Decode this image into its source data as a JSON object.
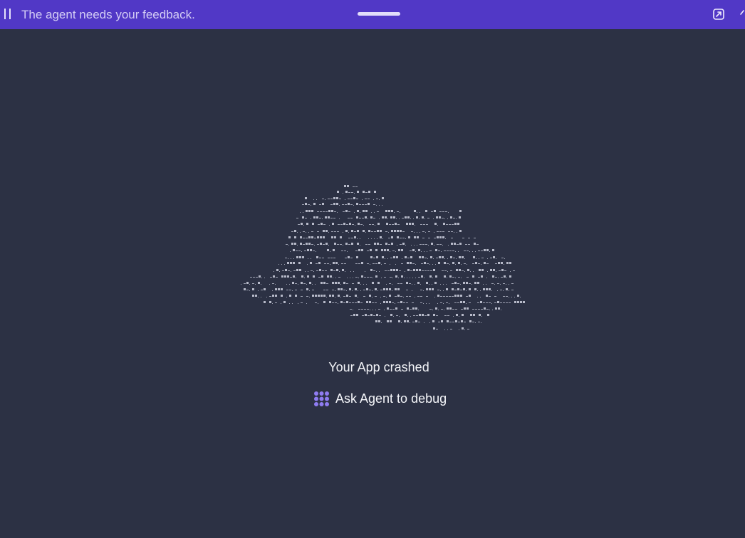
{
  "banner": {
    "message": "The agent needs your feedback."
  },
  "icons": {
    "pause": "pause-icon",
    "drag": "drag-handle",
    "open_external": "open-external-icon",
    "agent": "agent-icon"
  },
  "main": {
    "crash_title": "Your App crashed",
    "debug_button_label": "Ask Agent to debug"
  },
  "colors": {
    "banner_bg": "#5138c6",
    "page_bg": "#2c3144",
    "agent_icon": "#8f7cf2",
    "text": "#f2f3f7"
  }
}
